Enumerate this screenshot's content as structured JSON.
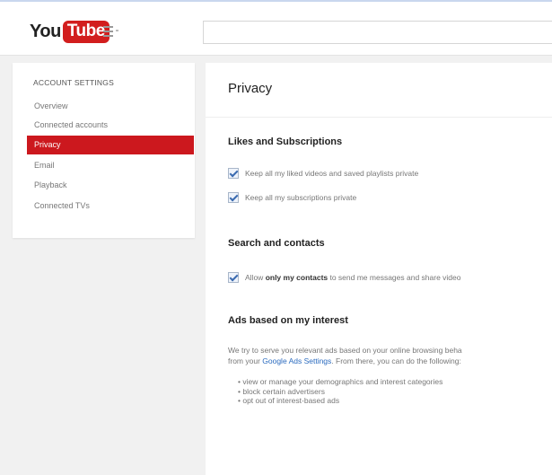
{
  "header": {
    "logo_you": "You",
    "logo_tube": "Tube",
    "search_placeholder": ""
  },
  "sidebar": {
    "heading": "ACCOUNT SETTINGS",
    "items": [
      {
        "label": "Overview",
        "active": false
      },
      {
        "label": "Connected accounts",
        "active": false
      },
      {
        "label": "Privacy",
        "active": true
      },
      {
        "label": "Email",
        "active": false
      },
      {
        "label": "Playback",
        "active": false
      },
      {
        "label": "Connected TVs",
        "active": false
      }
    ]
  },
  "main": {
    "title": "Privacy",
    "likes": {
      "title": "Likes and Subscriptions",
      "options": [
        {
          "label": "Keep all my liked videos and saved playlists private",
          "checked": true
        },
        {
          "label": "Keep all my subscriptions private",
          "checked": true
        }
      ]
    },
    "search": {
      "title": "Search and contacts",
      "option_prefix": "Allow ",
      "option_bold": "only my contacts",
      "option_suffix": " to send me messages and share video",
      "checked": true
    },
    "ads": {
      "title": "Ads based on my interest",
      "line1": "We try to serve you relevant ads based on your online browsing beha",
      "line2_prefix": "from your ",
      "line2_link": "Google Ads Settings",
      "line2_suffix": ". From there, you can do the following:",
      "bullets": [
        "view or manage your demographics and interest categories",
        "block certain advertisers",
        "opt out of interest-based ads"
      ]
    }
  },
  "colors": {
    "accent": "#cc181e",
    "link": "#2b6bbf",
    "background": "#f1f1f1"
  }
}
